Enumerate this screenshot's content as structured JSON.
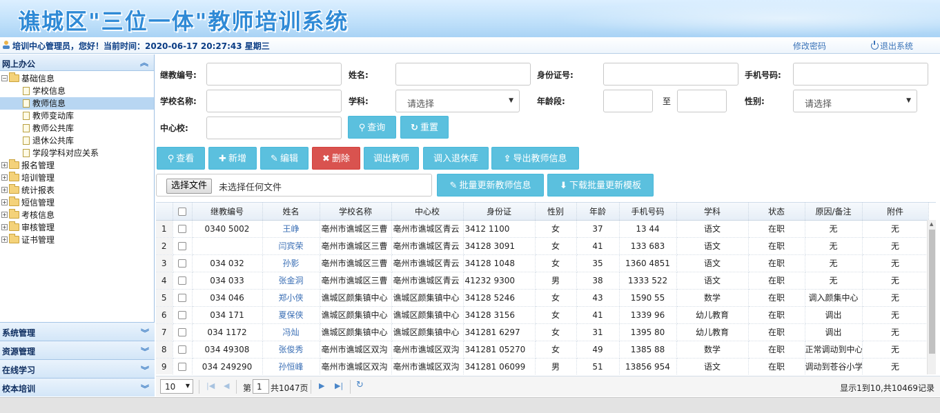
{
  "header": {
    "title": "谯城区\"三位一体\"教师培训系统"
  },
  "infobar": {
    "welcome": "培训中心管理员，您好！当前时间：2020-06-17 20:27:43 星期三",
    "change_password": "修改密码",
    "logout": "退出系统"
  },
  "sidebar": {
    "panel_title": "网上办公",
    "tree": [
      {
        "label": "基础信息",
        "type": "folder",
        "expanded": true,
        "level": 0
      },
      {
        "label": "学校信息",
        "type": "file",
        "level": 1
      },
      {
        "label": "教师信息",
        "type": "file",
        "level": 1,
        "selected": true
      },
      {
        "label": "教师变动库",
        "type": "file",
        "level": 1
      },
      {
        "label": "教师公共库",
        "type": "file",
        "level": 1
      },
      {
        "label": "退休公共库",
        "type": "file",
        "level": 1
      },
      {
        "label": "学段学科对应关系",
        "type": "file",
        "level": 1
      },
      {
        "label": "报名管理",
        "type": "folder",
        "level": 0
      },
      {
        "label": "培训管理",
        "type": "folder",
        "level": 0
      },
      {
        "label": "统计报表",
        "type": "folder",
        "level": 0
      },
      {
        "label": "短信管理",
        "type": "folder",
        "level": 0
      },
      {
        "label": "考核信息",
        "type": "folder",
        "level": 0
      },
      {
        "label": "审核管理",
        "type": "folder",
        "level": 0
      },
      {
        "label": "证书管理",
        "type": "folder",
        "level": 0
      }
    ],
    "bottom_panels": [
      "系统管理",
      "资源管理",
      "在线学习",
      "校本培训"
    ]
  },
  "filters": {
    "jixu_label": "继教编号:",
    "name_label": "姓名:",
    "id_label": "身份证号:",
    "phone_label": "手机号码:",
    "school_label": "学校名称:",
    "subject_label": "学科:",
    "subject_value": "请选择",
    "age_label": "年龄段:",
    "age_to": "至",
    "gender_label": "性别:",
    "gender_value": "请选择",
    "center_label": "中心校:",
    "search_btn": "查询",
    "reset_btn": "重置"
  },
  "toolbar": {
    "view": "查看",
    "add": "新增",
    "edit": "编辑",
    "delete": "删除",
    "transfer_out": "调出教师",
    "to_retire": "调入退休库",
    "export": "导出教师信息",
    "choose_file": "选择文件",
    "no_file": "未选择任何文件",
    "batch_update": "批量更新教师信息",
    "download_template": "下载批量更新模板"
  },
  "table": {
    "columns": [
      "继教编号",
      "姓名",
      "学校名称",
      "中心校",
      "身份证",
      "性别",
      "年龄",
      "手机号码",
      "学科",
      "状态",
      "原因/备注",
      "附件"
    ],
    "rows": [
      {
        "n": "1",
        "code": "0340   5002",
        "name": "王峥",
        "school": "亳州市谯城区三曹",
        "center": "亳州市谯城区青云",
        "id": "3412   1100",
        "gender": "女",
        "age": "37",
        "phone": "13   44",
        "subject": "语文",
        "status": "在职",
        "note": "无",
        "attach": "无"
      },
      {
        "n": "2",
        "code": "",
        "name": "闫宾荣",
        "school": "亳州市谯城区三曹",
        "center": "亳州市谯城区青云",
        "id": "34128   3091",
        "gender": "女",
        "age": "41",
        "phone": "133   683",
        "subject": "语文",
        "status": "在职",
        "note": "无",
        "attach": "无"
      },
      {
        "n": "3",
        "code": "034   032",
        "name": "孙影",
        "school": "亳州市谯城区三曹",
        "center": "亳州市谯城区青云",
        "id": "34128   1048",
        "gender": "女",
        "age": "35",
        "phone": "1360   4851",
        "subject": "语文",
        "status": "在职",
        "note": "无",
        "attach": "无"
      },
      {
        "n": "4",
        "code": "034   033",
        "name": "张金洞",
        "school": "亳州市谯城区三曹",
        "center": "亳州市谯城区青云",
        "id": "41232   9300",
        "gender": "男",
        "age": "38",
        "phone": "1333   522",
        "subject": "语文",
        "status": "在职",
        "note": "无",
        "attach": "无"
      },
      {
        "n": "5",
        "code": "034   046",
        "name": "郑小侠",
        "school": "谯城区颜集镇中心",
        "center": "谯城区颜集镇中心",
        "id": "34128   5246",
        "gender": "女",
        "age": "43",
        "phone": "1590   55",
        "subject": "数学",
        "status": "在职",
        "note": "调入颜集中心",
        "attach": "无"
      },
      {
        "n": "6",
        "code": "034   171",
        "name": "夏保侠",
        "school": "谯城区颜集镇中心",
        "center": "谯城区颜集镇中心",
        "id": "34128   3156",
        "gender": "女",
        "age": "41",
        "phone": "1339   96",
        "subject": "幼儿教育",
        "status": "在职",
        "note": "调出",
        "attach": "无"
      },
      {
        "n": "7",
        "code": "034   1172",
        "name": "冯灿",
        "school": "谯城区颜集镇中心",
        "center": "谯城区颜集镇中心",
        "id": "341281   6297",
        "gender": "女",
        "age": "31",
        "phone": "1395   80",
        "subject": "幼儿教育",
        "status": "在职",
        "note": "调出",
        "attach": "无"
      },
      {
        "n": "8",
        "code": "034   49308",
        "name": "张俊秀",
        "school": "亳州市谯城区双沟",
        "center": "亳州市谯城区双沟",
        "id": "341281   05270",
        "gender": "女",
        "age": "49",
        "phone": "1385   88",
        "subject": "数学",
        "status": "在职",
        "note": "正常调动到中心",
        "attach": "无"
      },
      {
        "n": "9",
        "code": "034   249290",
        "name": "孙恒峰",
        "school": "亳州市谯城区双沟",
        "center": "亳州市谯城区双沟",
        "id": "341281   06099",
        "gender": "男",
        "age": "51",
        "phone": "13856   954",
        "subject": "语文",
        "status": "在职",
        "note": "调动到苍谷小学",
        "attach": "无"
      }
    ]
  },
  "pager": {
    "page_size": "10",
    "page_prefix": "第",
    "page": "1",
    "total_pages": "共1047页",
    "summary": "显示1到10,共10469记录"
  }
}
